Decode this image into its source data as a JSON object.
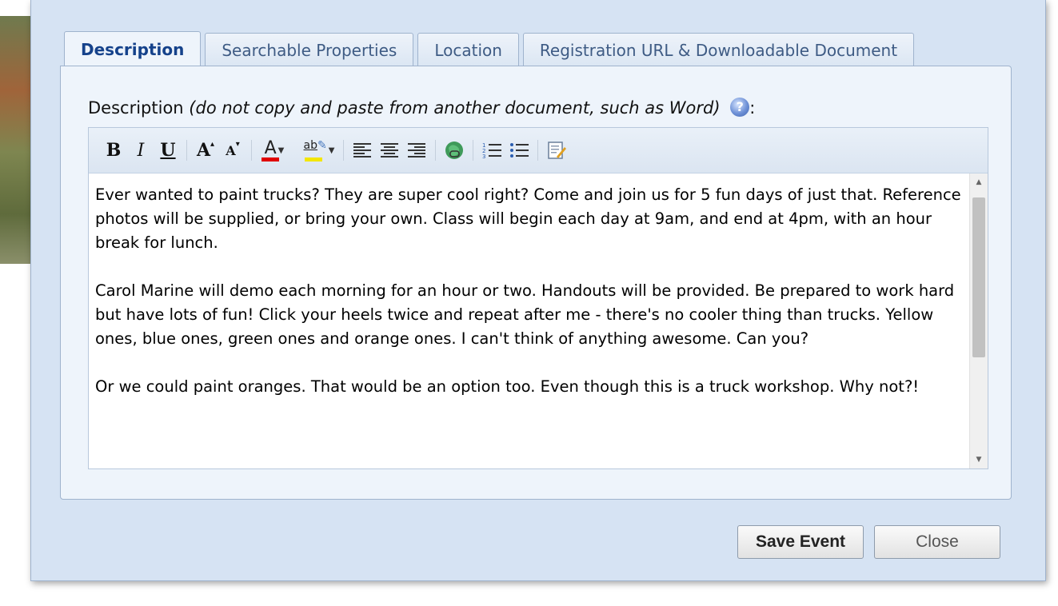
{
  "tabs": [
    {
      "label": "Description",
      "active": true
    },
    {
      "label": "Searchable Properties",
      "active": false
    },
    {
      "label": "Location",
      "active": false
    },
    {
      "label": "Registration URL & Downloadable Document",
      "active": false
    }
  ],
  "description_field": {
    "label": "Description",
    "hint": "(do not copy and paste from another document, such as Word)",
    "colon": ":"
  },
  "toolbar": {
    "bold": "B",
    "italic": "I",
    "underline": "U",
    "grow_font": "A",
    "shrink_font": "A",
    "font_color": "A",
    "highlight": "ab"
  },
  "editor": {
    "paragraphs": [
      "Ever wanted to paint trucks? They are super cool right? Come and join us for 5 fun days of just that. Reference photos will be supplied, or bring your own. Class will begin each day at 9am, and end at 4pm, with an hour break for lunch.",
      "Carol Marine will demo each morning for an hour or two. Handouts will be provided. Be prepared to work hard but have lots of fun! Click your heels twice and repeat after me - there's no cooler thing than trucks. Yellow ones, blue ones, green ones and orange ones. I can't think of anything awesome. Can you?",
      "Or we could paint oranges. That would be an option too. Even though this is a truck workshop. Why not?!"
    ]
  },
  "buttons": {
    "save": "Save Event",
    "close": "Close"
  },
  "colors": {
    "dialog_bg": "#d6e3f3",
    "tab_active_text": "#15428b",
    "font_color_swatch": "#e00000",
    "highlight_swatch": "#f3e600"
  },
  "icons": [
    "help-icon",
    "insert-link-icon",
    "numbered-list-icon",
    "bulleted-list-icon",
    "spellcheck-icon"
  ]
}
